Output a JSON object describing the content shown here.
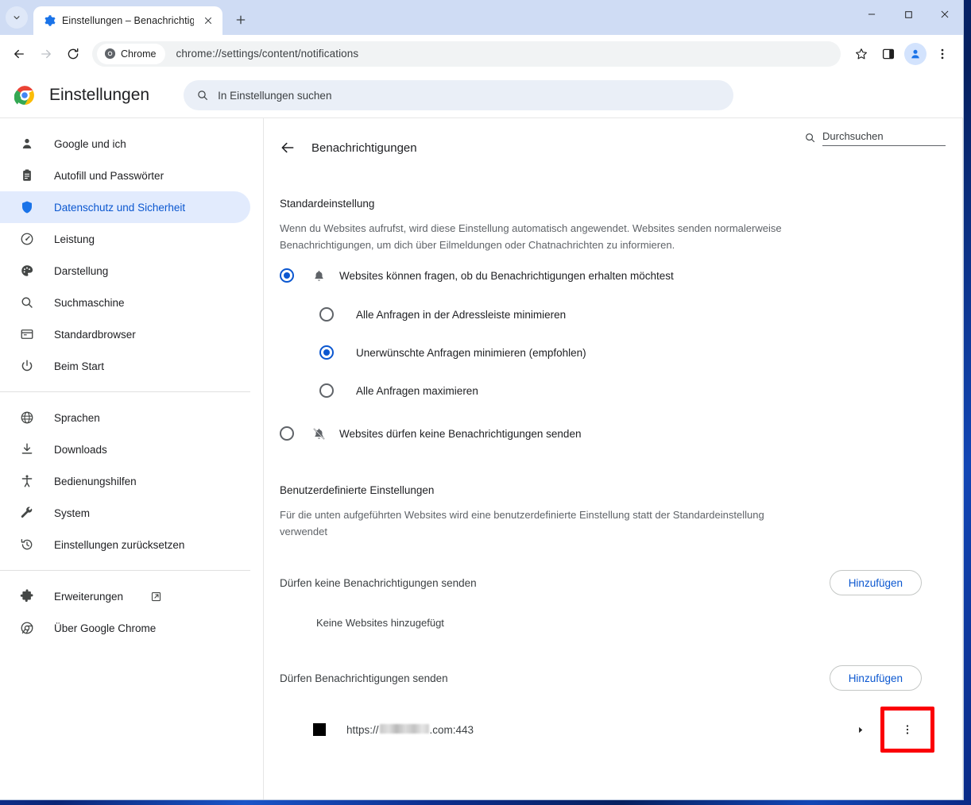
{
  "browser": {
    "tab": {
      "title": "Einstellungen – Benachrichtigun",
      "favicon_name": "settings-gear-icon",
      "close_label": "×"
    },
    "new_tab_label": "+",
    "tab_list_label": "⌄",
    "window_controls": {
      "minimize": "–",
      "maximize": "□",
      "close": "✕"
    },
    "toolbar": {
      "back_label": "←",
      "forward_label": "→",
      "reload_label": "⟳",
      "chrome_chip_label": "Chrome",
      "url": "chrome://settings/content/notifications",
      "bookmark_label": "☆",
      "side_panel_label": "▯",
      "profile_label": "person",
      "menu_label": "⋮"
    }
  },
  "settings": {
    "brand_title": "Einstellungen",
    "search_placeholder": "In Einstellungen suchen",
    "sidebar": {
      "groups": [
        {
          "items": [
            {
              "label": "Google und ich",
              "icon": "person-icon",
              "active": false
            },
            {
              "label": "Autofill und Passwörter",
              "icon": "clipboard-icon",
              "active": false
            },
            {
              "label": "Datenschutz und Sicherheit",
              "icon": "shield-icon",
              "active": true
            },
            {
              "label": "Leistung",
              "icon": "speedometer-icon",
              "active": false
            },
            {
              "label": "Darstellung",
              "icon": "palette-icon",
              "active": false
            },
            {
              "label": "Suchmaschine",
              "icon": "search-icon",
              "active": false
            },
            {
              "label": "Standardbrowser",
              "icon": "browser-window-icon",
              "active": false
            },
            {
              "label": "Beim Start",
              "icon": "power-icon",
              "active": false
            }
          ]
        },
        {
          "items": [
            {
              "label": "Sprachen",
              "icon": "globe-icon",
              "active": false
            },
            {
              "label": "Downloads",
              "icon": "download-icon",
              "active": false
            },
            {
              "label": "Bedienungshilfen",
              "icon": "accessibility-icon",
              "active": false
            },
            {
              "label": "System",
              "icon": "wrench-icon",
              "active": false
            },
            {
              "label": "Einstellungen zurücksetzen",
              "icon": "history-restore-icon",
              "active": false
            }
          ]
        },
        {
          "items": [
            {
              "label": "Erweiterungen",
              "icon": "puzzle-icon",
              "active": false,
              "external": true
            },
            {
              "label": "Über Google Chrome",
              "icon": "chrome-icon",
              "active": false
            }
          ]
        }
      ]
    }
  },
  "page": {
    "title": "Benachrichtigungen",
    "back_label": "←",
    "search_placeholder": "Durchsuchen",
    "default_section": {
      "title": "Standardeinstellung",
      "description": "Wenn du Websites aufrufst, wird diese Einstellung automatisch angewendet. Websites senden normalerweise Benachrichtigungen, um dich über Eilmeldungen oder Chatnachrichten zu informieren.",
      "options": [
        {
          "label": "Websites können fragen, ob du Benachrichtigungen erhalten möchtest",
          "icon": "bell-icon",
          "checked": true
        },
        {
          "label": "Websites dürfen keine Benachrichtigungen senden",
          "icon": "bell-off-icon",
          "checked": false
        }
      ],
      "sub_options": [
        {
          "label": "Alle Anfragen in der Adressleiste minimieren",
          "checked": false
        },
        {
          "label": "Unerwünschte Anfragen minimieren (empfohlen)",
          "checked": true
        },
        {
          "label": "Alle Anfragen maximieren",
          "checked": false
        }
      ]
    },
    "custom_section": {
      "title": "Benutzerdefinierte Einstellungen",
      "description": "Für die unten aufgeführten Websites wird eine benutzerdefinierte Einstellung statt der Standardeinstellung verwendet",
      "block_group": {
        "label": "Dürfen keine Benachrichtigungen senden",
        "add_label": "Hinzufügen",
        "empty_text": "Keine Websites hinzugefügt"
      },
      "allow_group": {
        "label": "Dürfen Benachrichtigungen senden",
        "add_label": "Hinzufügen",
        "site": {
          "prefix": "https://",
          "redacted": true,
          "suffix": ".com:443",
          "expand_label": "▸",
          "menu_label": "⋮"
        }
      }
    }
  },
  "colors": {
    "accent_blue": "#0b57d0",
    "active_nav_bg": "#e2ebfd",
    "highlight_red": "#fb0006",
    "tabstrip_bg": "#cfdcf4",
    "omnibox_bg": "#f1f3f4",
    "settings_search_bg": "#eaeff7"
  }
}
